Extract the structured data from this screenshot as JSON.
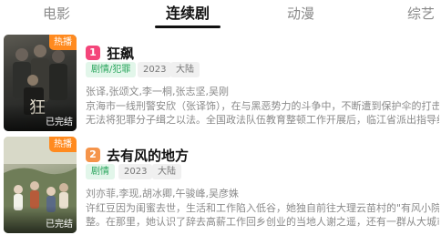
{
  "tabs": [
    {
      "label": "电影",
      "active": false
    },
    {
      "label": "连续剧",
      "active": true
    },
    {
      "label": "动漫",
      "active": false
    },
    {
      "label": "综艺",
      "active": false
    }
  ],
  "items": [
    {
      "rank": "1",
      "title": "狂飙",
      "badge": "热播",
      "status": "已完结",
      "genre": "剧情/犯罪",
      "year": "2023",
      "region": "大陆",
      "cast": "张译,张颂文,李一桐,张志坚,吴刚",
      "desc_line1": "京海市一线刑警安欣（张译饰），在与黑恶势力的斗争中，不断遭到保护伞的打击，始终",
      "desc_line2": "无法将犯罪分子缉之以法。全国政法队伍教育整顿工作开展后，临江省派出指导组入驻…"
    },
    {
      "rank": "2",
      "title": "去有风的地方",
      "badge": "热播",
      "status": "已完结",
      "genre": "剧情",
      "year": "2023",
      "region": "大陆",
      "cast": "刘亦菲,李现,胡冰卿,午骏峰,吴彦姝",
      "desc_line1": "许红豆因为闺蜜去世，生活和工作陷入低谷，她独自前往大理云苗村的\"有风小院\"休息调",
      "desc_line2": "整。在那里，她认识了辞去高薪工作回乡创业的当地人谢之遥，还有一群从大城市过去…"
    }
  ],
  "colors": {
    "rank1": "#f4457a",
    "rank2": "#f5944a",
    "hot_badge": "#ff8a1f",
    "genre_tag_text": "#2aa55d",
    "genre_tag_bg": "#e2f6ea"
  }
}
